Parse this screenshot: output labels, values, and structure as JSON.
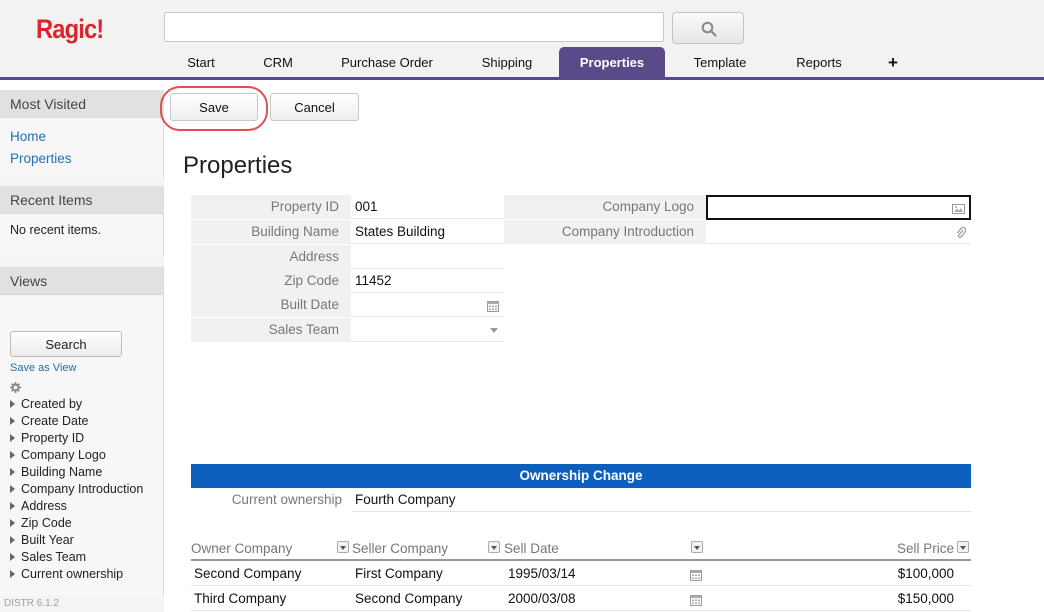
{
  "app": {
    "logo": "Ragic!",
    "version": "DISTR 6.1.2"
  },
  "search": {
    "value": "",
    "placeholder": ""
  },
  "tabs": [
    {
      "label": "Start"
    },
    {
      "label": "CRM"
    },
    {
      "label": "Purchase Order"
    },
    {
      "label": "Shipping"
    },
    {
      "label": "Properties",
      "active": true
    },
    {
      "label": "Template"
    },
    {
      "label": "Reports"
    },
    {
      "label": "+"
    }
  ],
  "sidebar": {
    "most_visited": {
      "title": "Most Visited",
      "links": [
        "Home",
        "Properties"
      ]
    },
    "recent_items": {
      "title": "Recent Items",
      "empty_text": "No recent items."
    },
    "views": {
      "title": "Views",
      "search_label": "Search",
      "save_as_view": "Save as View",
      "items": [
        "Created by",
        "Create Date",
        "Property ID",
        "Company Logo",
        "Building Name",
        "Company Introduction",
        "Address",
        "Zip Code",
        "Built Year",
        "Sales Team",
        "Current ownership"
      ]
    }
  },
  "toolbar": {
    "save_label": "Save",
    "cancel_label": "Cancel"
  },
  "form": {
    "title": "Properties",
    "left_fields": [
      {
        "label": "Property ID",
        "value": "001"
      },
      {
        "label": "Building Name",
        "value": "States Building"
      },
      {
        "label": "Address",
        "value": ""
      },
      {
        "label": "Zip Code",
        "value": "11452"
      },
      {
        "label": "Built Date",
        "value": ""
      },
      {
        "label": "Sales Team",
        "value": ""
      }
    ],
    "right_fields": [
      {
        "label": "Company Logo",
        "value": ""
      },
      {
        "label": "Company Introduction",
        "value": ""
      }
    ]
  },
  "ownership": {
    "section_title": "Ownership Change",
    "current_label": "Current ownership",
    "current_value": "Fourth Company",
    "columns": [
      "Owner Company",
      "Seller Company",
      "Sell Date",
      "Sell Price"
    ],
    "rows": [
      {
        "owner": "Second Company",
        "seller": "First Company",
        "date": "1995/03/14",
        "price": "$100,000"
      },
      {
        "owner": "Third Company",
        "seller": "Second Company",
        "date": "2000/03/08",
        "price": "$150,000"
      }
    ]
  },
  "colors": {
    "brand": "#d9262c",
    "tab_active": "#5b4a8a",
    "section_header": "#0d5fbe",
    "link": "#1d6fb8",
    "highlight": "#e05050"
  }
}
